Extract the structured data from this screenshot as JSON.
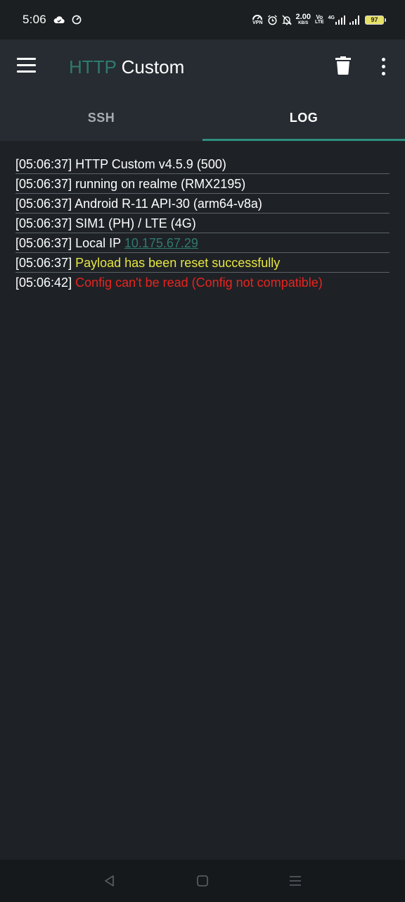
{
  "status_bar": {
    "time": "5:06",
    "speed_value": "2.00",
    "speed_unit": "KB/S",
    "vpn_label": "VPN",
    "volte_top": "Vo",
    "volte_bottom": "LTE",
    "network_type": "4G",
    "battery_level": "97",
    "icons": [
      "cloud-icon",
      "speedometer-icon",
      "vpn-icon",
      "alarm-icon",
      "mute-bell-icon",
      "volte-icon",
      "signal-icon",
      "battery-icon"
    ]
  },
  "app_bar": {
    "title_part1": "HTTP",
    "title_part2": "Custom",
    "icons": [
      "menu-icon",
      "trash-icon",
      "more-vert-icon"
    ]
  },
  "tabs": [
    {
      "label": "SSH",
      "active": false
    },
    {
      "label": "LOG",
      "active": true
    }
  ],
  "log": {
    "lines": [
      {
        "time": "[05:06:37]",
        "text": "HTTP Custom v4.5.9 (500)",
        "color": "#ffffff"
      },
      {
        "time": "[05:06:37]",
        "text": "running on realme (RMX2195)",
        "color": "#ffffff"
      },
      {
        "time": "[05:06:37]",
        "text": "Android R-11 API-30 (arm64-v8a)",
        "color": "#ffffff"
      },
      {
        "time": "[05:06:37]",
        "text": "SIM1 (PH) / LTE (4G)",
        "color": "#ffffff"
      },
      {
        "time": "[05:06:37]",
        "text": "Local IP",
        "link": "10.175.67.29",
        "link_color": "#2f7a70"
      },
      {
        "time": "[05:06:37]",
        "text": "Payload has been reset successfully",
        "color": "#e8e640"
      },
      {
        "time": "[05:06:42]",
        "text": "Config can't be read (Config not compatible)",
        "color": "#e8241f"
      }
    ]
  },
  "nav_bar": {
    "icons": [
      "back-icon",
      "home-icon",
      "recents-icon"
    ]
  },
  "colors": {
    "background": "#1e2226",
    "app_bar": "#262c31",
    "accent": "#2f8f7f",
    "title_accent": "#2f7a70"
  }
}
